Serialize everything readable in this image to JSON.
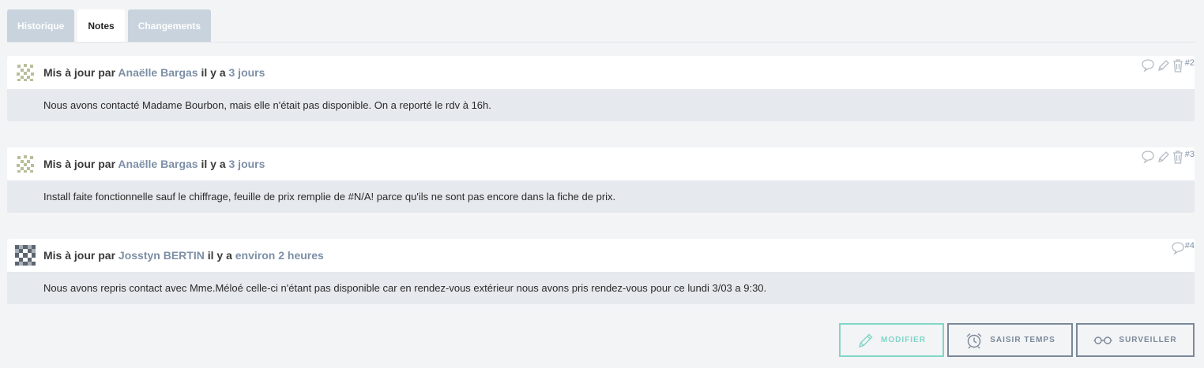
{
  "tabs": [
    {
      "label": "Historique"
    },
    {
      "label": "Notes"
    },
    {
      "label": "Changements"
    }
  ],
  "notes": [
    {
      "prefix": "Mis à jour par",
      "author": "Anaëlle Bargas",
      "mid": "il y a",
      "time": "3 jours",
      "number": "#2",
      "text": "Nous avons contacté Madame Bourbon, mais elle n'était pas disponible. On a reporté le rdv à 16h."
    },
    {
      "prefix": "Mis à jour par",
      "author": "Anaëlle Bargas",
      "mid": "il y a",
      "time": "3 jours",
      "number": "#3",
      "text": "Install faite fonctionnelle sauf le chiffrage, feuille de prix remplie de #N/A! parce qu'ils ne sont pas encore dans la fiche de prix."
    },
    {
      "prefix": "Mis à jour par",
      "author": "Josstyn BERTIN",
      "mid": "il y a",
      "time": "environ 2 heures",
      "number": "#4",
      "text": "Nous avons repris contact avec Mme.Méloé celle-ci n'étant pas disponible car en rendez-vous extérieur nous avons pris rendez-vous pour ce lundi 3/03 a 9:30."
    }
  ],
  "buttons": {
    "modify": "MODIFIER",
    "log_time": "SAISIR TEMPS",
    "watch": "SURVEILLER"
  },
  "icons": {
    "quote": "speech-bubble-icon",
    "edit": "pencil-icon",
    "delete": "trash-icon",
    "alarm": "alarm-clock-icon",
    "watch": "glasses-icon"
  },
  "colors": {
    "accent": "#7fd6c7",
    "link": "#7d8fa6",
    "tab_inactive": "#c9d3dd"
  }
}
